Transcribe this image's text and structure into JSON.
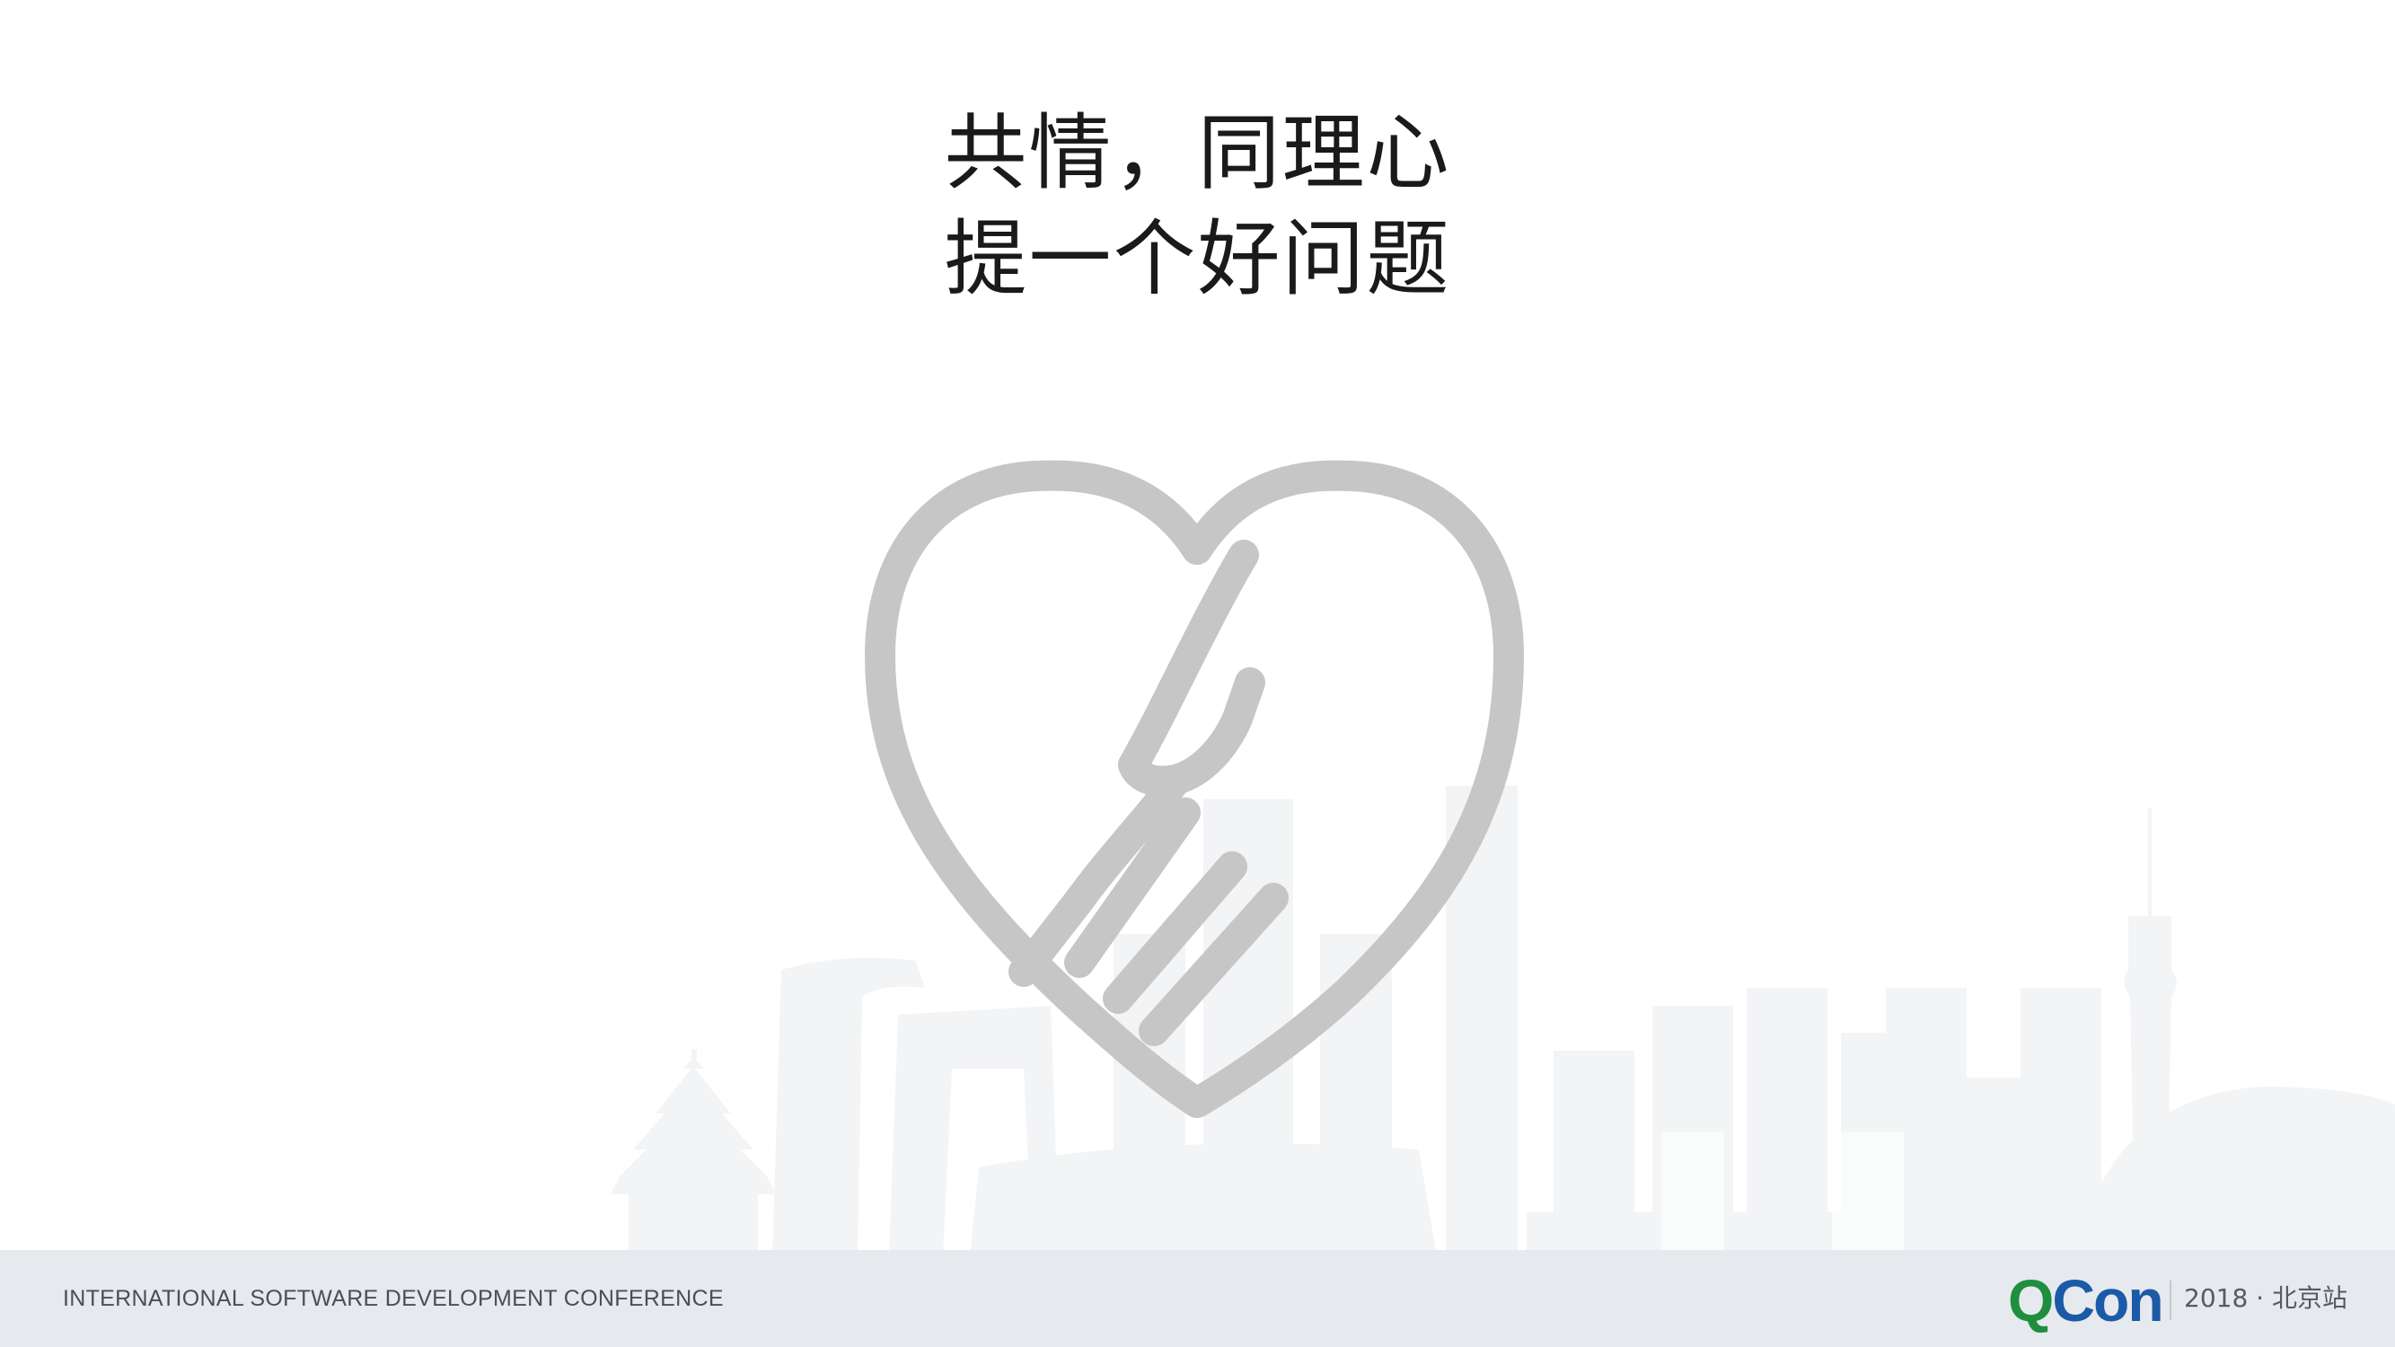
{
  "slide": {
    "title_lines": [
      "共情，同理心",
      "提一个好问题"
    ]
  },
  "footer": {
    "conference_text": "INTERNATIONAL SOFTWARE DEVELOPMENT CONFERENCE",
    "logo_q": "Q",
    "logo_con": "Con",
    "edition": "2018 · 北京站"
  },
  "colors": {
    "heart": "#c6c6c6",
    "skyline": "#f3f4f6",
    "footer_bg": "#e6e9ed",
    "logo_green": "#1f8f3f",
    "logo_blue": "#1b5aa6"
  },
  "icons": {
    "main_graphic": "heart-handshake-icon",
    "background": "beijing-skyline-illustration"
  }
}
